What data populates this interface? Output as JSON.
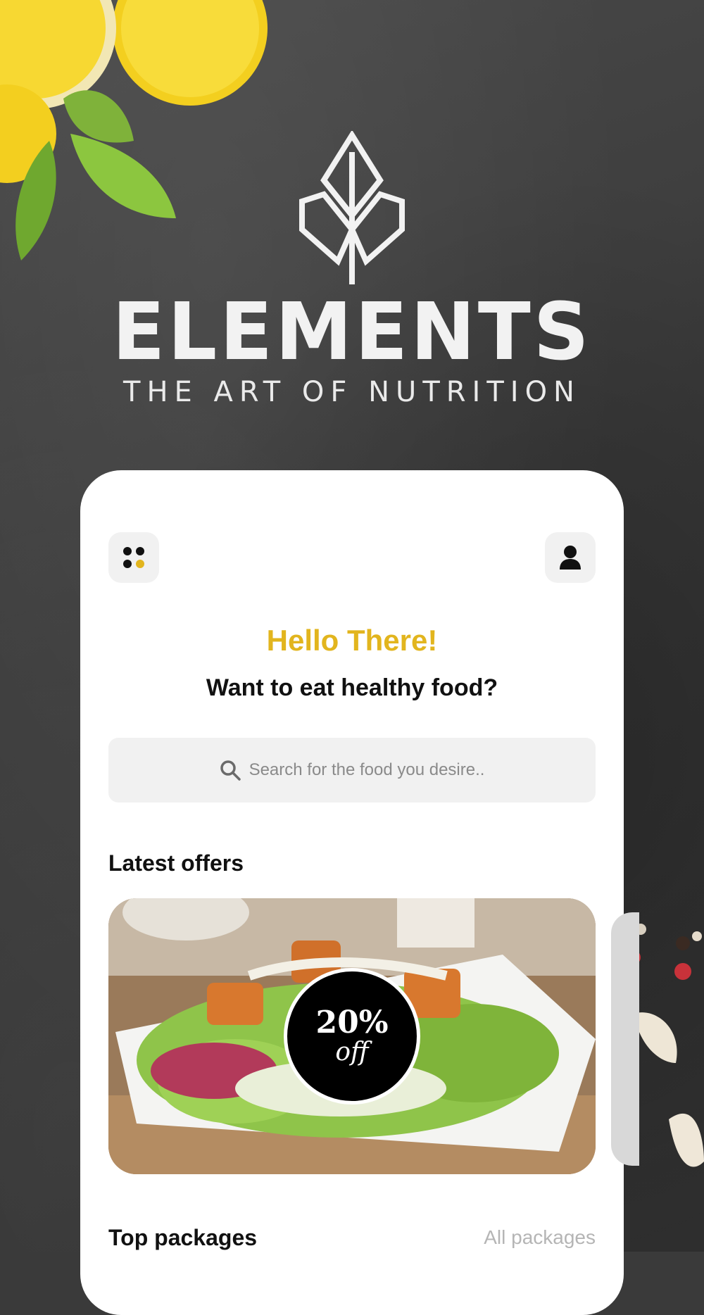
{
  "brand": {
    "wordmark": "ELEMENTS",
    "tagline": "THE ART OF NUTRITION"
  },
  "header": {
    "menu_icon": "dots-grid-icon",
    "profile_icon": "user-icon"
  },
  "greeting": {
    "title": "Hello There!",
    "subtitle": "Want to eat healthy food?"
  },
  "search": {
    "placeholder": "Search for the food you desire..",
    "icon": "search-icon"
  },
  "offers": {
    "title": "Latest offers",
    "items": [
      {
        "badge_value": "20%",
        "badge_unit": "off"
      }
    ]
  },
  "packages": {
    "title": "Top packages",
    "link": "All packages"
  },
  "colors": {
    "accent": "#e2b51e",
    "card_bg": "#ffffff",
    "button_bg": "#f1f1f1",
    "background": "#3a3a3a"
  }
}
